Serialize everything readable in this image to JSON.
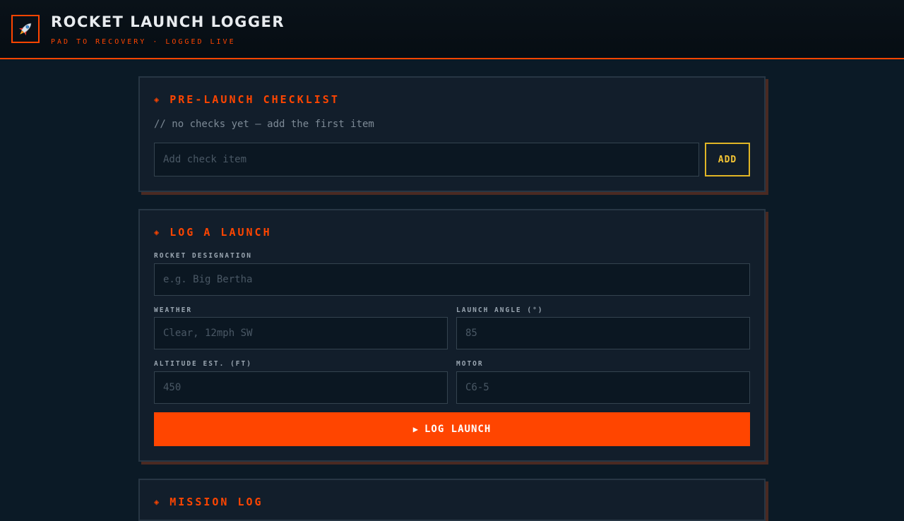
{
  "header": {
    "title": "ROCKET LAUNCH LOGGER",
    "subtitle": "PAD TO RECOVERY · LOGGED LIVE",
    "logo_icon": "rocket-icon"
  },
  "checklist": {
    "heading": "PRE-LAUNCH CHECKLIST",
    "empty_note": "// no checks yet — add the first item",
    "input_placeholder": "Add check item",
    "add_label": "ADD"
  },
  "log_launch": {
    "heading": "LOG A LAUNCH",
    "rocket_label": "ROCKET DESIGNATION",
    "rocket_placeholder": "e.g. Big Bertha",
    "weather_label": "WEATHER",
    "weather_placeholder": "Clear, 12mph SW",
    "angle_label": "LAUNCH ANGLE (°)",
    "angle_placeholder": "85",
    "altitude_label": "ALTITUDE EST. (FT)",
    "altitude_placeholder": "450",
    "motor_label": "MOTOR",
    "motor_placeholder": "C6-5",
    "submit_label": "LOG LAUNCH"
  },
  "mission_log": {
    "heading": "MISSION LOG"
  },
  "colors": {
    "accent": "#ff4500",
    "add_button": "#f4c534",
    "background": "#0b1a26",
    "panel": "#121e2b"
  }
}
